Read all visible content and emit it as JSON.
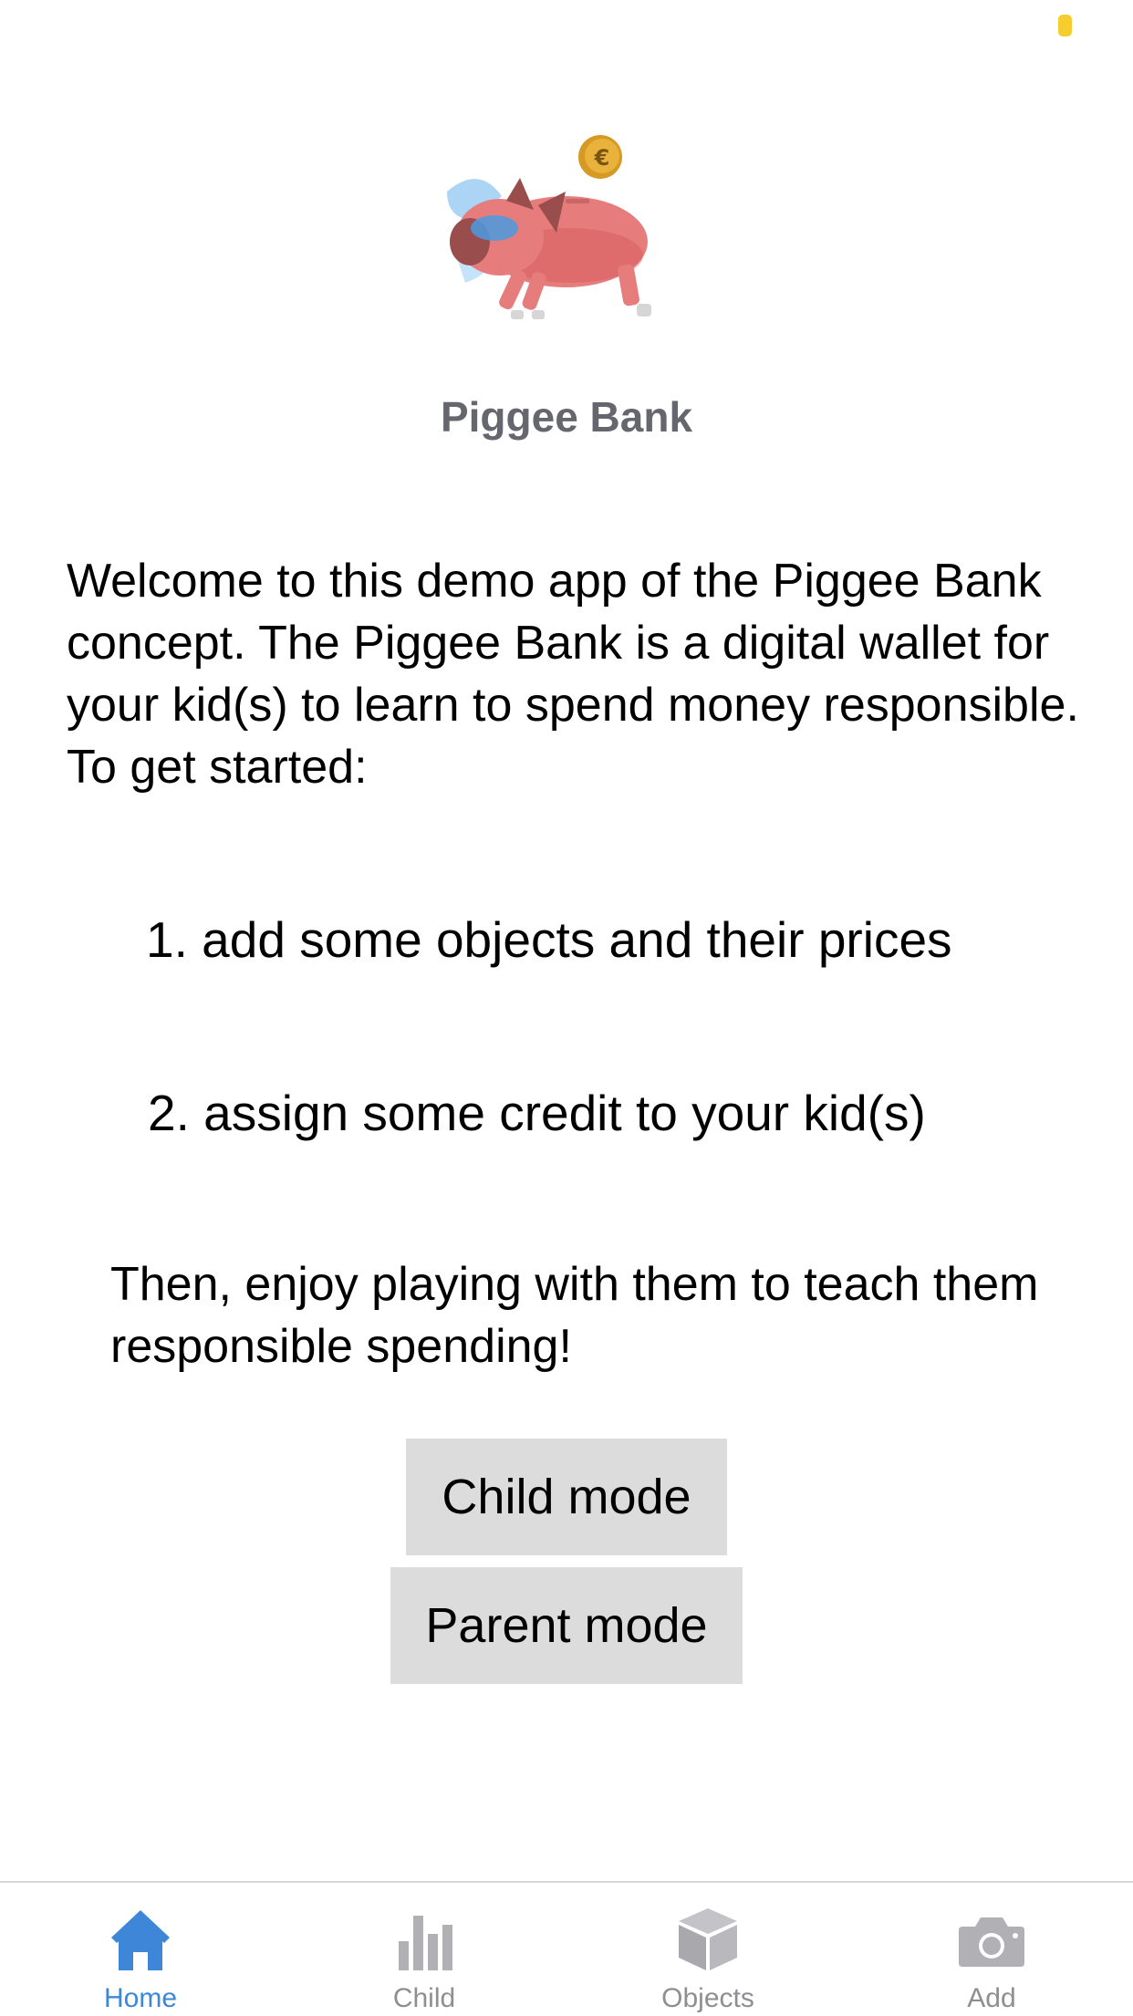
{
  "app": {
    "title": "Piggee Bank"
  },
  "content": {
    "intro": "Welcome to this demo app of the Piggee Bank concept. The Piggee Bank is a digital wallet for your kid(s) to learn to spend money responsible. To get started:",
    "step_1": "1. add some objects and their prices",
    "step_2": "2. assign some credit to your kid(s)",
    "outro": "Then, enjoy playing with them to teach them responsible spending!"
  },
  "buttons": {
    "child_mode": "Child mode",
    "parent_mode": "Parent mode"
  },
  "tabbar": {
    "active_index": 0,
    "tabs": [
      {
        "label": "Home",
        "icon": "house-icon"
      },
      {
        "label": "Child",
        "icon": "bar-chart-icon"
      },
      {
        "label": "Objects",
        "icon": "cube-icon"
      },
      {
        "label": "Add",
        "icon": "camera-icon"
      }
    ]
  },
  "colors": {
    "active_tab": "#3d86d8",
    "inactive_tab": "#8e8e93",
    "button_bg": "#dcdcdc",
    "title": "#66666e",
    "status_dot": "#f5cd2e",
    "pig": "#e77c7c",
    "coin": "#e9b23c"
  }
}
